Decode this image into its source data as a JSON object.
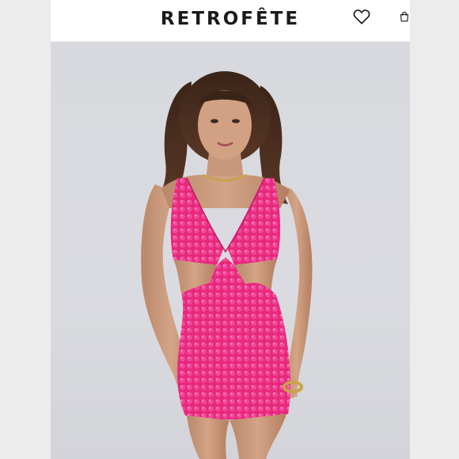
{
  "header": {
    "brand": "RETROFÊTE"
  },
  "icons": {
    "wishlist": "heart-icon",
    "cart": "shopping-bag-icon"
  },
  "colors": {
    "dress": "#e8287a",
    "background": "#d9dadf",
    "header": "#ffffff"
  }
}
